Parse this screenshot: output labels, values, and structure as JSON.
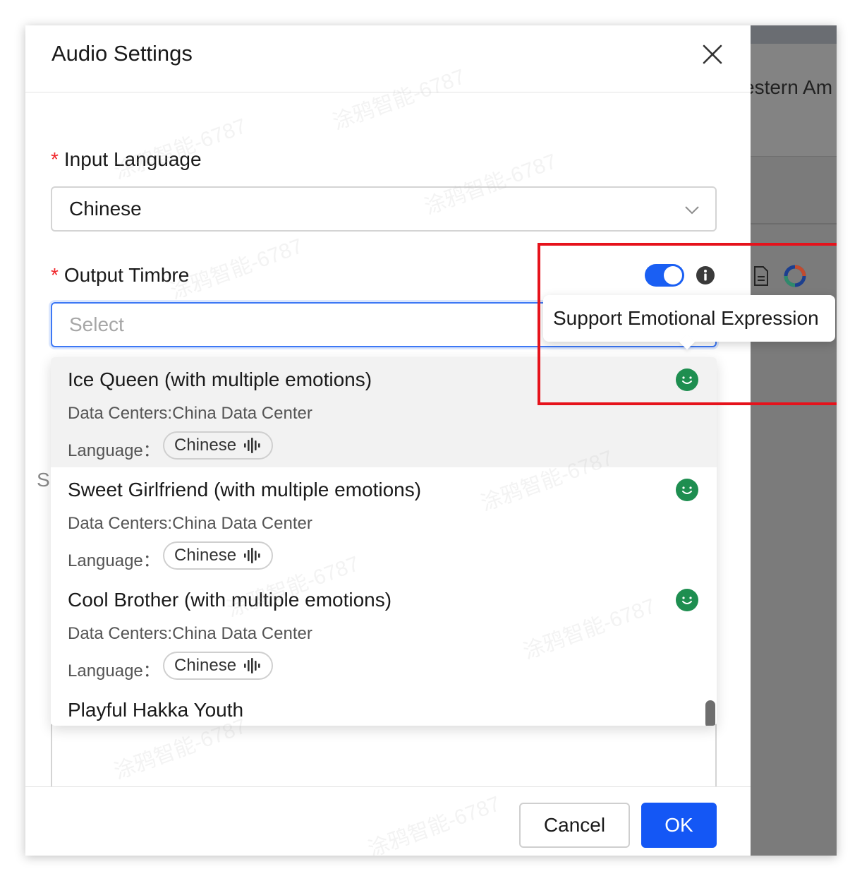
{
  "dialog": {
    "title": "Audio Settings",
    "close_icon": "close-icon"
  },
  "input_language": {
    "label": "Input Language",
    "required_mark": "*",
    "value": "Chinese"
  },
  "output_timbre": {
    "label": "Output Timbre",
    "required_mark": "*",
    "placeholder": "Select",
    "emotion_toggle_on": true,
    "toggle_color": "#1a5ff3"
  },
  "tooltip": {
    "text": "Support Emotional Expression"
  },
  "hidden_label_fragment": "S",
  "dropdown": {
    "options": [
      {
        "title": "Ice Queen (with multiple emotions)",
        "data_center": "Data Centers:China Data Center",
        "language_label": "Language：",
        "language": "Chinese",
        "emotion_icon": "smile-icon",
        "active": true
      },
      {
        "title": "Sweet Girlfriend (with multiple emotions)",
        "data_center": "Data Centers:China Data Center",
        "language_label": "Language：",
        "language": "Chinese",
        "emotion_icon": "smile-icon",
        "active": false
      },
      {
        "title": "Cool Brother (with multiple emotions)",
        "data_center": "Data Centers:China Data Center",
        "language_label": "Language：",
        "language": "Chinese",
        "emotion_icon": "smile-icon",
        "active": false
      },
      {
        "title": "Playful Hakka Youth"
      }
    ]
  },
  "footer": {
    "cancel_label": "Cancel",
    "ok_label": "OK",
    "ok_color": "#1457f5"
  },
  "background_app": {
    "text_fragment": "estern Am"
  },
  "watermark": "涂鸦智能-6787",
  "colors": {
    "required": "#f0262b",
    "emotion_icon": "#1e8e50",
    "highlight_box": "#e6121b"
  }
}
